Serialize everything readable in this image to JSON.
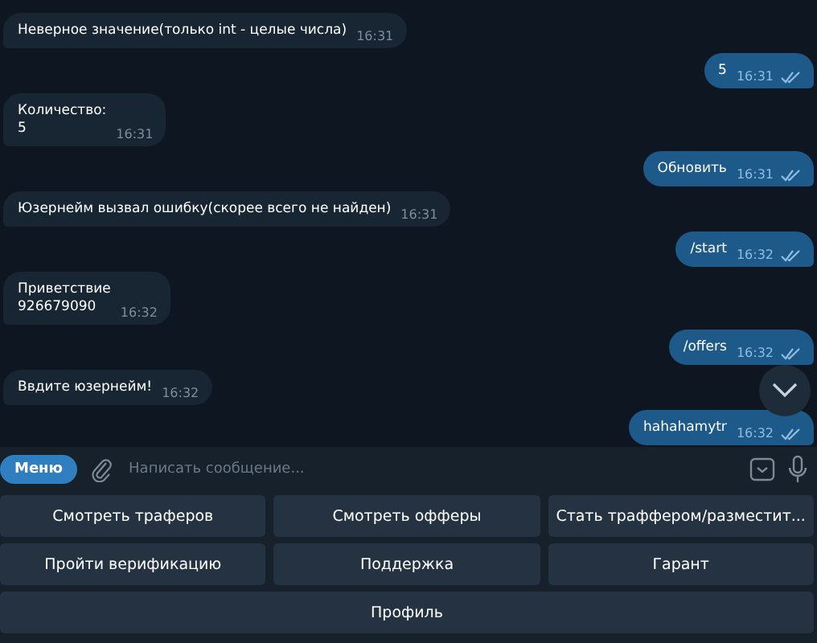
{
  "messages": [
    {
      "kind": "incoming",
      "text": "Неверное значение(только int - целые числа)",
      "time": "16:31"
    },
    {
      "kind": "outgoing",
      "text": "5",
      "time": "16:31",
      "read": true
    },
    {
      "kind": "incoming",
      "text": "Количество:\n5",
      "time": "16:31"
    },
    {
      "kind": "outgoing",
      "text": "Обновить",
      "time": "16:31",
      "read": true
    },
    {
      "kind": "incoming",
      "text": "Юзернейм вызвал ошибку(скорее всего не найден)",
      "time": "16:31"
    },
    {
      "kind": "outgoing",
      "text": "/start",
      "time": "16:32",
      "read": true
    },
    {
      "kind": "incoming",
      "text": "Приветствие\n926679090",
      "time": "16:32"
    },
    {
      "kind": "outgoing",
      "text": "/offers",
      "time": "16:32",
      "read": true
    },
    {
      "kind": "incoming",
      "text": "Ввдите юзернейм!",
      "time": "16:32"
    },
    {
      "kind": "outgoing",
      "text": "hahahamytr",
      "time": "16:32",
      "read": true
    }
  ],
  "composer": {
    "menu_label": "Меню",
    "placeholder": "Написать сообщение..."
  },
  "keyboard": [
    [
      "Смотреть траферов",
      "Смотреть офферы",
      "Стать траффером/разместит..."
    ],
    [
      "Пройти верификацию",
      "Поддержка",
      "Гарант"
    ],
    [
      "Профиль"
    ]
  ]
}
